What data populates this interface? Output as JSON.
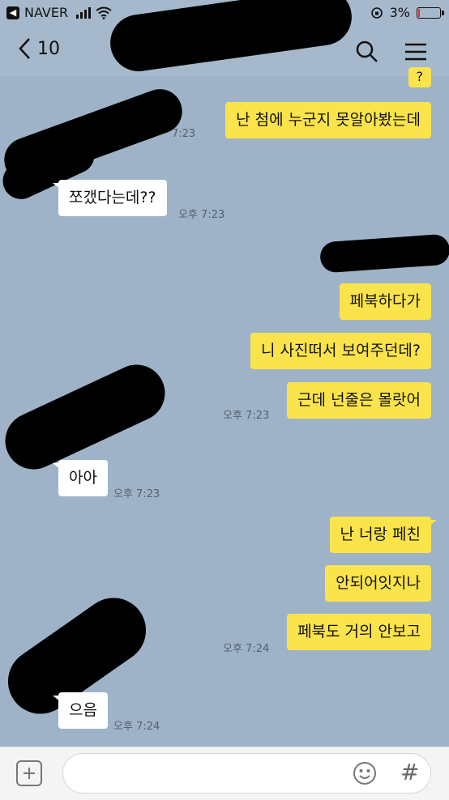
{
  "status_bar": {
    "carrier": "NAVER",
    "battery": "3%",
    "battery_level": 0.03
  },
  "header": {
    "back_count": "10",
    "search_icon": "search-icon",
    "menu_icon": "menu-icon"
  },
  "messages": [
    {
      "text": "?",
      "side": "me",
      "time": ""
    },
    {
      "text": "난 첨에 누군지 못알아봤는데",
      "side": "me",
      "time": "7:23"
    },
    {
      "text": "쪼갰다는데??",
      "side": "them",
      "time": "오후 7:23"
    },
    {
      "text": "페북하다가",
      "side": "me",
      "time": ""
    },
    {
      "text": "니 사진떠서 보여주던데?",
      "side": "me",
      "time": ""
    },
    {
      "text": "근데 넌줄은 몰랏어",
      "side": "me",
      "time": "오후 7:23"
    },
    {
      "text": "아아",
      "side": "them",
      "time": "오후 7:23"
    },
    {
      "text": "난 너랑 페친",
      "side": "me",
      "time": ""
    },
    {
      "text": "안되어잇지나",
      "side": "me",
      "time": ""
    },
    {
      "text": "페북도 거의 안보고",
      "side": "me",
      "time": "오후 7:24"
    },
    {
      "text": "으음",
      "side": "them",
      "time": "오후 7:24"
    }
  ],
  "input": {
    "placeholder": "",
    "value": ""
  },
  "colors": {
    "background": "#9fb3c8",
    "my_bubble": "#fbe44b",
    "their_bubble": "#ffffff"
  }
}
